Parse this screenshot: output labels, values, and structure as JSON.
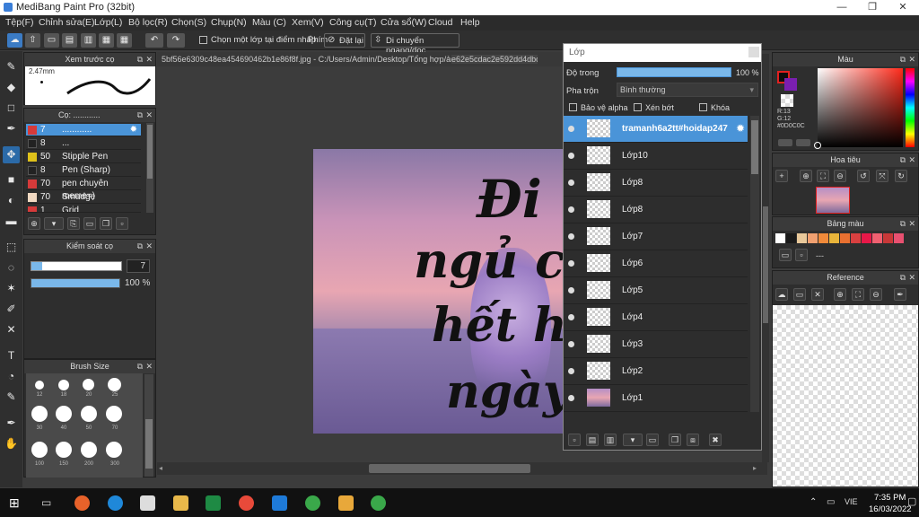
{
  "window": {
    "title": "MediBang Paint Pro (32bit)",
    "minimize": "—",
    "maximize": "❐",
    "close": "✕"
  },
  "menu": [
    "Tệp(F)",
    "Chỉnh sửa(E)",
    "Lớp(L)",
    "Bộ lọc(R)",
    "Chọn(S)",
    "Chụp(N)",
    "Màu (C)",
    "Xem(V)",
    "Công cụ(T)",
    "Cửa sổ(W)",
    "Cloud",
    "Help"
  ],
  "toolbar": {
    "select_layer_at_point": "Chọn một lớp tại điểm nhấp",
    "key_label": "Phím",
    "reset": "Đặt lại",
    "move_hv": "Di chuyển ngang/dọc"
  },
  "document": {
    "tab1": "5bf56e6309c48ea454690462b1e86f8f.jpg - C:/Users/Admin/Desktop/Tổng hợp/ảnh=)))",
    "tab2": "e62e5cdac2e592dd4dbcb471bad"
  },
  "brush_preview": {
    "title": "Xem trước cọ",
    "size": "2.47mm"
  },
  "brushes": {
    "title": "Cọ: ............",
    "items": [
      {
        "num": "7",
        "name": "............",
        "color": "#d63a3a"
      },
      {
        "num": "8",
        "name": "...",
        "color": "#222222"
      },
      {
        "num": "50",
        "name": "Stipple Pen",
        "color": "#e0c21a"
      },
      {
        "num": "8",
        "name": "Pen (Sharp)",
        "color": "#222222"
      },
      {
        "num": "70",
        "name": "pen chuyên meme=)",
        "color": "#d63a3a"
      },
      {
        "num": "70",
        "name": "Smudge",
        "color": "#f1d9c2"
      },
      {
        "num": "1",
        "name": "Grid",
        "color": "#d63a3a"
      }
    ]
  },
  "brush_control": {
    "title": "Kiểm soát cọ",
    "size_value": "7",
    "opacity_value": "100 %",
    "opacity_level": 1.0
  },
  "brush_size": {
    "title": "Brush Size",
    "labels": [
      "12",
      "18",
      "20",
      "25",
      "30",
      "40",
      "50",
      "70",
      "100",
      "150",
      "200",
      "300"
    ]
  },
  "canvas_text": [
    "Đi",
    "ngủ ch",
    "hết hê",
    "ngày"
  ],
  "layer_panel": {
    "title": "Lớp",
    "opacity_label": "Độ trong",
    "opacity_value": "100 %",
    "opacity_level": 1.0,
    "blend_label": "Pha trộn",
    "blend_value": "Bình thường",
    "protect_alpha": "Bảo vệ alpha",
    "clipping": "Xén bớt",
    "lock": "Khóa",
    "layers": [
      "tramanh6a2tt#hoidap247",
      "Lớp10",
      "Lớp8",
      "Lớp8",
      "Lớp7",
      "Lớp6",
      "Lớp5",
      "Lớp4",
      "Lớp3",
      "Lớp2",
      "Lớp1"
    ]
  },
  "color_panel": {
    "title": "Màu",
    "r": "R:13",
    "g": "G:12",
    "hex": "#0D0C0C"
  },
  "navigator": {
    "title": "Hoa tiêu"
  },
  "palette": {
    "title": "Bảng màu",
    "placeholder": "---",
    "swatches": [
      "#ffffff",
      "#1a1a1a",
      "#e8c89a",
      "#f0a070",
      "#f08a3a",
      "#e8b43a",
      "#e87030",
      "#d84040",
      "#e81848",
      "#f06070",
      "#c83838",
      "#e85070"
    ]
  },
  "reference": {
    "title": "Reference"
  },
  "taskbar": {
    "time": "7:35 PM",
    "date": "16/03/2022",
    "lang": "VIE"
  }
}
